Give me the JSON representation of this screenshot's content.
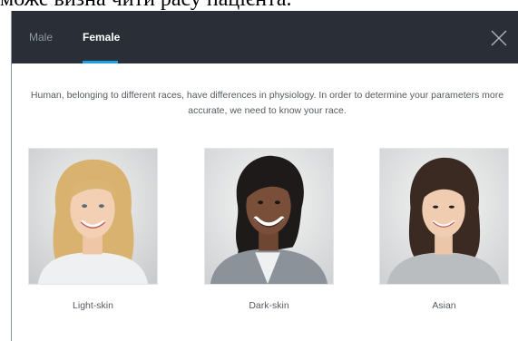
{
  "caption": "може визна чити расу пацієнта.",
  "tabs": [
    {
      "label": "Male",
      "active": false
    },
    {
      "label": "Female",
      "active": true
    }
  ],
  "close_icon": "close-icon",
  "intro_text": "Human, belonging to different races, have differences in physiology. In order to determine your parameters more accurate, we need to know your race.",
  "options": [
    {
      "label": "Light-skin"
    },
    {
      "label": "Dark-skin"
    },
    {
      "label": "Asian"
    }
  ],
  "colors": {
    "header_bg": "#2a2f37",
    "active_tab_underline": "#1ea0e6",
    "inactive_tab": "#8f98a3",
    "body_text": "#555a60"
  }
}
